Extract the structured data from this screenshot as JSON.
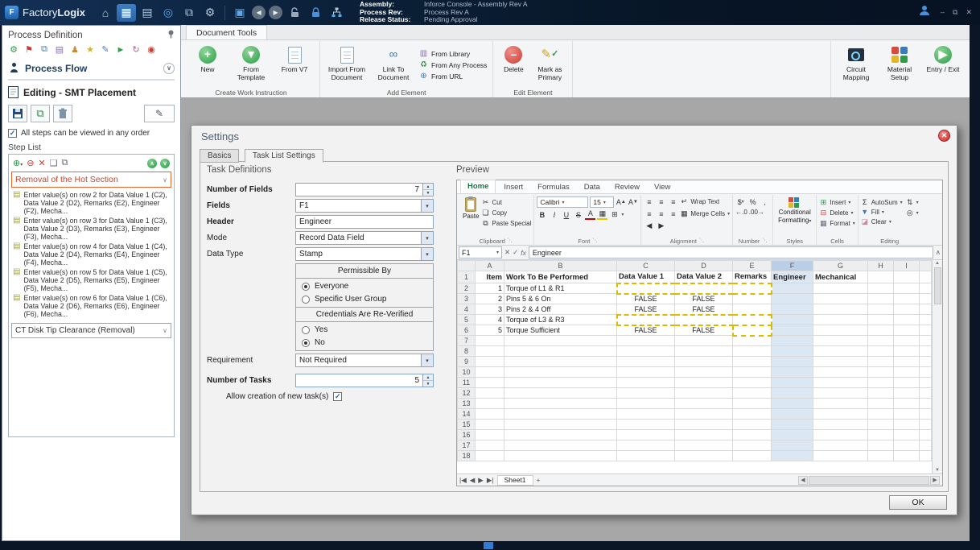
{
  "titlebar": {
    "app_name_a": "Factory",
    "app_name_b": "Logix",
    "assembly_label": "Assembly:",
    "assembly_value": "Inforce Console - Assembly Rev A",
    "process_rev_label": "Process Rev:",
    "process_rev_value": "Process Rev A",
    "release_label": "Release Status:",
    "release_value": "Pending Approval"
  },
  "sidebar": {
    "title": "Process Definition",
    "process_flow": "Process Flow",
    "editing": "Editing - SMT Placement",
    "order_checkbox": "All steps can be viewed in any order",
    "step_list_title": "Step List",
    "active_step": "Removal of the Hot Section",
    "steps": [
      "Enter value(s) on row 2 for Data Value 1 (C2), Data Value 2 (D2), Remarks (E2), Engineer (F2), Mecha...",
      "Enter value(s) on row 3 for Data Value 1 (C3), Data Value 2 (D3), Remarks (E3), Engineer (F3), Mecha...",
      "Enter value(s) on row 4 for Data Value 1 (C4), Data Value 2 (D4), Remarks (E4), Engineer (F4), Mecha...",
      "Enter value(s) on row 5 for Data Value 1 (C5), Data Value 2 (D5), Remarks (E5), Engineer (F5), Mecha...",
      "Enter value(s) on row 6 for Data Value 1 (C6), Data Value 2 (D6), Remarks (E6), Engineer (F6), Mecha..."
    ],
    "collapsed_step": "CT Disk Tip Clearance (Removal)"
  },
  "ribbon": {
    "tab": "Document Tools",
    "create": {
      "label": "Create Work Instruction",
      "new": "New",
      "from_template": "From Template",
      "from_v7": "From V7"
    },
    "add": {
      "label": "Add Element",
      "import_doc": "Import From Document",
      "link_doc": "Link To Document",
      "from_library": "From Library",
      "from_any_process": "From Any Process",
      "from_url": "From URL"
    },
    "edit": {
      "label": "Edit Element",
      "delete": "Delete",
      "mark_primary": "Mark as Primary"
    },
    "tools": {
      "circuit": "Circuit Mapping",
      "material": "Material Setup",
      "entry_exit": "Entry / Exit"
    }
  },
  "dialog": {
    "title": "Settings",
    "tab_basics": "Basics",
    "tab_task_list": "Task List Settings",
    "ok": "OK",
    "task": {
      "title": "Task Definitions",
      "number_of_fields_label": "Number of Fields",
      "number_of_fields_value": "7",
      "fields_label": "Fields",
      "fields_value": "F1",
      "header_label": "Header",
      "header_value": "Engineer",
      "mode_label": "Mode",
      "mode_value": "Record Data Field",
      "data_type_label": "Data Type",
      "data_type_value": "Stamp",
      "permissible_title": "Permissible By",
      "everyone": "Everyone",
      "specific_group": "Specific User Group",
      "credentials_title": "Credentials Are Re-Verified",
      "yes": "Yes",
      "no": "No",
      "requirement_label": "Requirement",
      "requirement_value": "Not Required",
      "number_of_tasks_label": "Number of Tasks",
      "number_of_tasks_value": "5",
      "allow_creation": "Allow creation of new task(s)"
    },
    "preview": {
      "title": "Preview",
      "excel": {
        "tabs": [
          "Home",
          "Insert",
          "Formulas",
          "Data",
          "Review",
          "View"
        ],
        "active_tab": "Home",
        "clipboard": {
          "label": "Clipboard",
          "paste": "Paste",
          "cut": "Cut",
          "copy": "Copy",
          "paste_special": "Paste Special"
        },
        "font": {
          "label": "Font",
          "family": "Calibri",
          "size": "15"
        },
        "alignment": {
          "label": "Alignment",
          "wrap": "Wrap Text",
          "merge": "Merge Cells"
        },
        "number_group": {
          "label": "Number"
        },
        "styles": {
          "label": "Styles",
          "conditional_1": "Conditional",
          "conditional_2": "Formatting"
        },
        "cells": {
          "label": "Cells",
          "insert": "Insert",
          "delete": "Delete",
          "format": "Format"
        },
        "editing": {
          "label": "Editing",
          "autosum": "AutoSum",
          "fill": "Fill",
          "clear": "Clear"
        },
        "name_box": "F1",
        "formula_value": "Engineer",
        "columns": [
          "A",
          "B",
          "C",
          "D",
          "E",
          "F",
          "G",
          "H",
          "I"
        ],
        "selected_column": "F",
        "header_row": [
          "Item",
          "Work To Be Performed",
          "Data Value 1",
          "Data Value 2",
          "Remarks",
          "Engineer",
          "Mechanical",
          "",
          ""
        ],
        "rows": [
          [
            "1",
            "Torque of L1 & R1",
            "",
            "",
            "",
            "",
            "",
            "",
            ""
          ],
          [
            "2",
            "Pins 5 & 6 On",
            "FALSE",
            "FALSE",
            "",
            "",
            "",
            "",
            ""
          ],
          [
            "3",
            "Pins 2 & 4 Off",
            "FALSE",
            "FALSE",
            "",
            "",
            "",
            "",
            ""
          ],
          [
            "4",
            "Torque of L3 & R3",
            "",
            "",
            "",
            "",
            "",
            "",
            ""
          ],
          [
            "5",
            "Torque Sufficient",
            "FALSE",
            "FALSE",
            "",
            "",
            "",
            "",
            ""
          ]
        ],
        "total_rows": 18,
        "dashed_ranges": [
          {
            "row": 2,
            "cols": [
              "C",
              "D",
              "E"
            ]
          },
          {
            "row": 5,
            "cols": [
              "C",
              "D",
              "E"
            ]
          },
          {
            "row": 6,
            "cols": [
              "E"
            ]
          }
        ],
        "sheet_tab": "Sheet1",
        "new_sheet": "+"
      }
    }
  },
  "icons": {
    "home": "⌂",
    "grid": "▦",
    "archive": "▤",
    "disc": "◎",
    "copy": "⧉",
    "gear": "⚙",
    "save": "▣",
    "back": "◀",
    "forward": "▶",
    "minimize": "–",
    "restore": "⧉",
    "close": "✕",
    "chevron_down": "∨",
    "chevron_up": "∧",
    "dropdown": "▾",
    "plus": "+",
    "minus": "–",
    "cross": "✕",
    "check": "✓",
    "pencil": "✎",
    "scissors": "✂",
    "copy_small": "❏",
    "sigma": "Σ",
    "fx": "fx",
    "books": "▥",
    "recycle": "♻",
    "globe": "⊕",
    "link": "∞",
    "percent": "%",
    "comma": ",",
    "dollar": "$",
    "wrap": "↵",
    "merge": "▦",
    "borders": "⊞",
    "align": "≡",
    "up": "▲",
    "down": "▼",
    "left": "◀",
    "right": "▶",
    "nav_first": "|◀",
    "nav_prev": "◀",
    "nav_next": "▶",
    "nav_last": "▶|",
    "sort": "⇅",
    "find": "◎",
    "eraser": "◪",
    "bold": "B",
    "italic": "I",
    "underline": "U",
    "strike": "S",
    "font_color": "A",
    "dec_left": "←.0",
    "dec_right": ".00→",
    "launcher": "⋱",
    "step_doc": "▤",
    "flag": "⚑",
    "star": "★",
    "play": "►",
    "refresh": "↻",
    "record": "◉",
    "pawn": "♟",
    "insert_cells": "⊞",
    "delete_cells": "⊟"
  }
}
